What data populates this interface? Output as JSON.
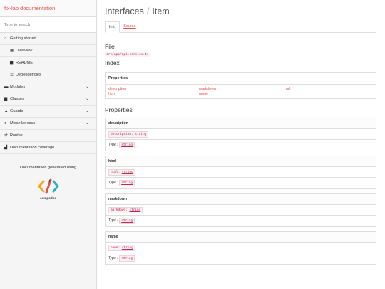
{
  "sidebar": {
    "brand": "fix-lab documentation",
    "search_placeholder": "Type to search",
    "items": [
      {
        "label": "Getting started",
        "icon": "home-icon",
        "glyph": "⌂"
      },
      {
        "label": "Overview",
        "icon": "grid-icon",
        "glyph": "▦"
      },
      {
        "label": "README",
        "icon": "book-icon",
        "glyph": "▆"
      },
      {
        "label": "Dependencies",
        "icon": "list-icon",
        "glyph": "☰"
      },
      {
        "label": "Modules",
        "icon": "module-icon",
        "glyph": "▬"
      },
      {
        "label": "Classes",
        "icon": "file-icon",
        "glyph": "▆"
      },
      {
        "label": "Guards",
        "icon": "shield-icon",
        "glyph": "▲"
      },
      {
        "label": "Miscellaneous",
        "icon": "cube-icon",
        "glyph": "●"
      },
      {
        "label": "Routes",
        "icon": "routes-icon",
        "glyph": "⇄"
      },
      {
        "label": "Documentation coverage",
        "icon": "bar-chart-icon",
        "glyph": "▟"
      }
    ],
    "generated_label": "Documentation generated using",
    "logo_text": "compodoc"
  },
  "main": {
    "title_part1": "Interfaces",
    "title_sep": "/",
    "title_part2": "Item",
    "tabs": [
      {
        "label": "Info"
      },
      {
        "label": "Source"
      }
    ],
    "file_heading": "File",
    "file_path": "src/app/api.service.ts",
    "index_heading": "Index",
    "index_box_heading": "Properties",
    "index_links": [
      "description",
      "markdown",
      "url",
      "html",
      "name"
    ],
    "properties_heading": "Properties",
    "properties": [
      {
        "name": "description",
        "type": "string"
      },
      {
        "name": "html",
        "type": "string"
      },
      {
        "name": "markdown",
        "type": "string"
      },
      {
        "name": "name",
        "type": "string"
      }
    ],
    "type_label": "Type :"
  }
}
